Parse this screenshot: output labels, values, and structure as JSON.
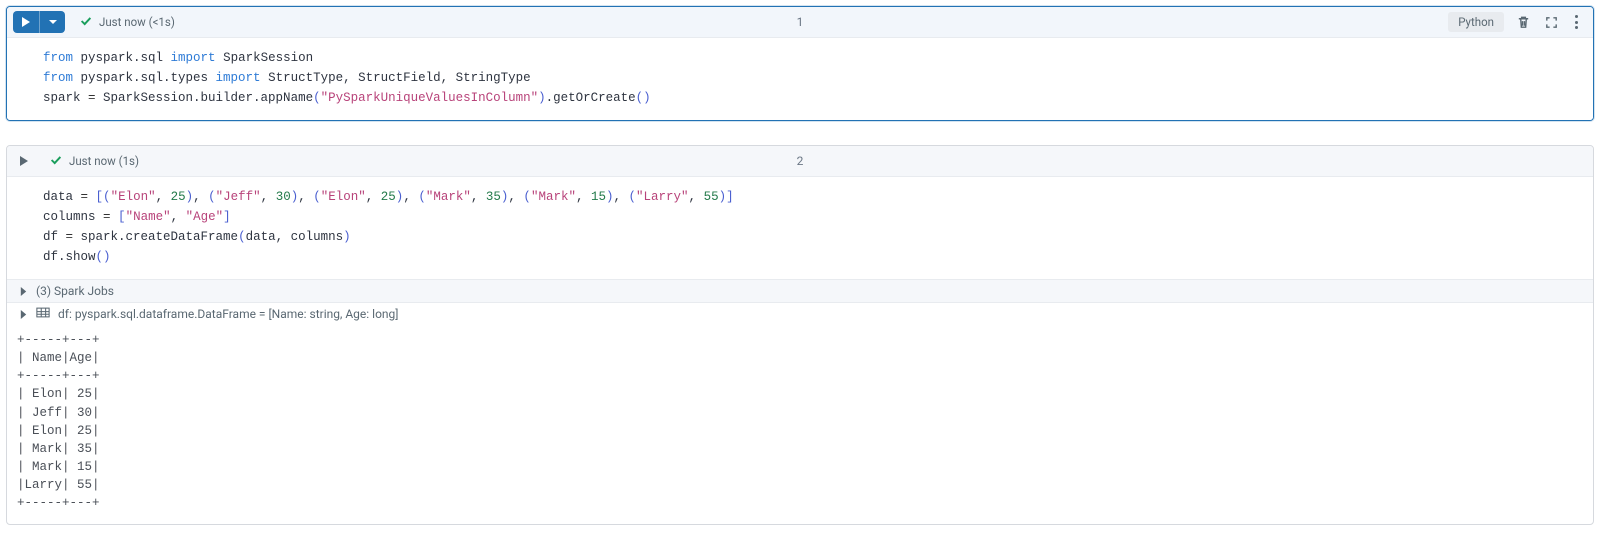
{
  "cells": [
    {
      "number": "1",
      "status_text": "Just now (<1s)",
      "language": "Python",
      "code_html": "<span class='kw'>from</span> pyspark.sql <span class='imp'>import</span> SparkSession\n<span class='kw'>from</span> pyspark.sql.types <span class='imp'>import</span> StructType, StructField, StringType\nspark <span class='pun'>=</span> SparkSession.builder.appName<span class='par'>(</span><span class='str'>\"PySparkUniqueValuesInColumn\"</span><span class='par'>)</span>.getOrCreate<span class='par'>()</span>"
    },
    {
      "number": "2",
      "status_text": "Just now (1s)",
      "code_html": "data <span class='pun'>=</span> <span class='par'>[(</span><span class='str'>\"Elon\"</span>, <span class='num'>25</span><span class='par'>)</span>, <span class='par'>(</span><span class='str'>\"Jeff\"</span>, <span class='num'>30</span><span class='par'>)</span>, <span class='par'>(</span><span class='str'>\"Elon\"</span>, <span class='num'>25</span><span class='par'>)</span>, <span class='par'>(</span><span class='str'>\"Mark\"</span>, <span class='num'>35</span><span class='par'>)</span>, <span class='par'>(</span><span class='str'>\"Mark\"</span>, <span class='num'>15</span><span class='par'>)</span>, <span class='par'>(</span><span class='str'>\"Larry\"</span>, <span class='num'>55</span><span class='par'>)]</span>\ncolumns <span class='pun'>=</span> <span class='par'>[</span><span class='str'>\"Name\"</span>, <span class='str'>\"Age\"</span><span class='par'>]</span>\ndf <span class='pun'>=</span> spark.createDataFrame<span class='par'>(</span>data, columns<span class='par'>)</span>\ndf.show<span class='par'>()</span>",
      "spark_jobs_label": "(3) Spark Jobs",
      "df_schema_label": "df:  pyspark.sql.dataframe.DataFrame = [Name: string, Age: long]",
      "output_text": "+-----+---+\n| Name|Age|\n+-----+---+\n| Elon| 25|\n| Jeff| 30|\n| Elon| 25|\n| Mark| 35|\n| Mark| 15|\n|Larry| 55|\n+-----+---+"
    }
  ]
}
